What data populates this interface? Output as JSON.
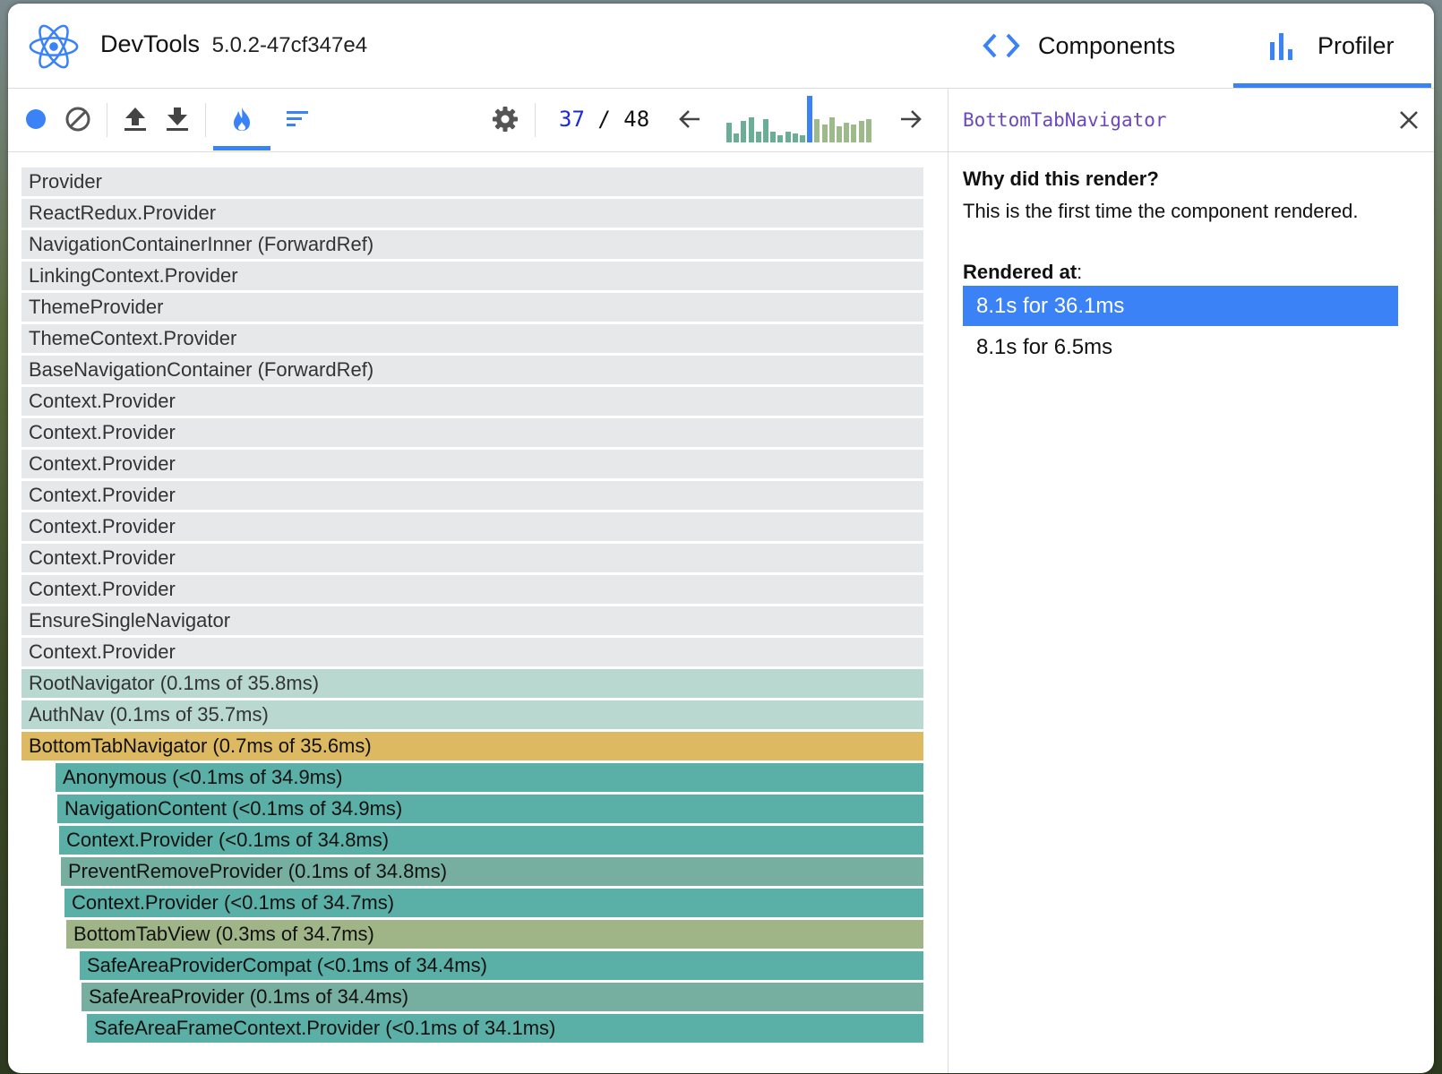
{
  "app": {
    "name": "DevTools",
    "version": "5.0.2-47cf347e4"
  },
  "tabs": [
    {
      "label": "Components",
      "icon": "code-brackets-icon"
    },
    {
      "label": "Profiler",
      "icon": "bar-chart-icon"
    }
  ],
  "toolbar": {
    "record_icon": "record-icon",
    "clear_icon": "clear-icon",
    "upload_icon": "upload-icon",
    "download_icon": "download-icon",
    "flamegraph_icon": "flame-icon",
    "ranked_icon": "ranked-chart-icon",
    "settings_icon": "gear-icon",
    "commit_current": "37",
    "commit_separator": " / ",
    "commit_total": "48",
    "commit_bar_levels": [
      0.55,
      0.25,
      0.6,
      0.7,
      0.3,
      0.65,
      0.3,
      0.2,
      0.3,
      0.25,
      0.2,
      1.0,
      0.65,
      0.5,
      0.7,
      0.45,
      0.55,
      0.5,
      0.6,
      0.65
    ],
    "selected_commit_index": 11
  },
  "colors": {
    "accent": "#3b82f6",
    "selected_row": "#ddb962",
    "unrendered_row": "#e7e8ea"
  },
  "flamegraph": {
    "rows": [
      {
        "label": "Provider",
        "style": "gray",
        "indent": 0
      },
      {
        "label": "ReactRedux.Provider",
        "style": "gray",
        "indent": 0
      },
      {
        "label": "NavigationContainerInner (ForwardRef)",
        "style": "gray",
        "indent": 0
      },
      {
        "label": "LinkingContext.Provider",
        "style": "gray",
        "indent": 0
      },
      {
        "label": "ThemeProvider",
        "style": "gray",
        "indent": 0
      },
      {
        "label": "ThemeContext.Provider",
        "style": "gray",
        "indent": 0
      },
      {
        "label": "BaseNavigationContainer (ForwardRef)",
        "style": "gray",
        "indent": 0
      },
      {
        "label": "Context.Provider",
        "style": "gray",
        "indent": 0
      },
      {
        "label": "Context.Provider",
        "style": "gray",
        "indent": 0
      },
      {
        "label": "Context.Provider",
        "style": "gray",
        "indent": 0
      },
      {
        "label": "Context.Provider",
        "style": "gray",
        "indent": 0
      },
      {
        "label": "Context.Provider",
        "style": "gray",
        "indent": 0
      },
      {
        "label": "Context.Provider",
        "style": "gray",
        "indent": 0
      },
      {
        "label": "Context.Provider",
        "style": "gray",
        "indent": 0
      },
      {
        "label": "EnsureSingleNavigator",
        "style": "gray",
        "indent": 0
      },
      {
        "label": "Context.Provider",
        "style": "gray",
        "indent": 0
      },
      {
        "label": "RootNavigator (0.1ms of 35.8ms)",
        "style": "mint",
        "indent": 0
      },
      {
        "label": "AuthNav (0.1ms of 35.7ms)",
        "style": "mint",
        "indent": 0
      },
      {
        "label": "BottomTabNavigator (0.7ms of 35.6ms)",
        "style": "selected",
        "indent": 0
      },
      {
        "label": "Anonymous (<0.1ms of 34.9ms)",
        "style": "teal",
        "indent": 38
      },
      {
        "label": "NavigationContent (<0.1ms of 34.9ms)",
        "style": "teal",
        "indent": 40
      },
      {
        "label": "Context.Provider (<0.1ms of 34.8ms)",
        "style": "teal",
        "indent": 42
      },
      {
        "label": "PreventRemoveProvider (0.1ms of 34.8ms)",
        "style": "sage",
        "indent": 44
      },
      {
        "label": "Context.Provider (<0.1ms of 34.7ms)",
        "style": "teal",
        "indent": 48
      },
      {
        "label": "BottomTabView (0.3ms of 34.7ms)",
        "style": "olive",
        "indent": 50
      },
      {
        "label": "SafeAreaProviderCompat (<0.1ms of 34.4ms)",
        "style": "teal",
        "indent": 65
      },
      {
        "label": "SafeAreaProvider (0.1ms of 34.4ms)",
        "style": "sage",
        "indent": 67
      },
      {
        "label": "SafeAreaFrameContext.Provider (<0.1ms of 34.1ms)",
        "style": "teal",
        "indent": 73
      }
    ]
  },
  "sidebar": {
    "selected_component": "BottomTabNavigator",
    "close_icon": "close-icon",
    "why_heading": "Why did this render?",
    "why_text": "This is the first time the component rendered.",
    "rendered_heading": "Rendered at",
    "rendered_colon": ":",
    "renders": [
      {
        "label": "8.1s for 36.1ms",
        "active": true
      },
      {
        "label": "8.1s for 6.5ms",
        "active": false
      }
    ]
  }
}
